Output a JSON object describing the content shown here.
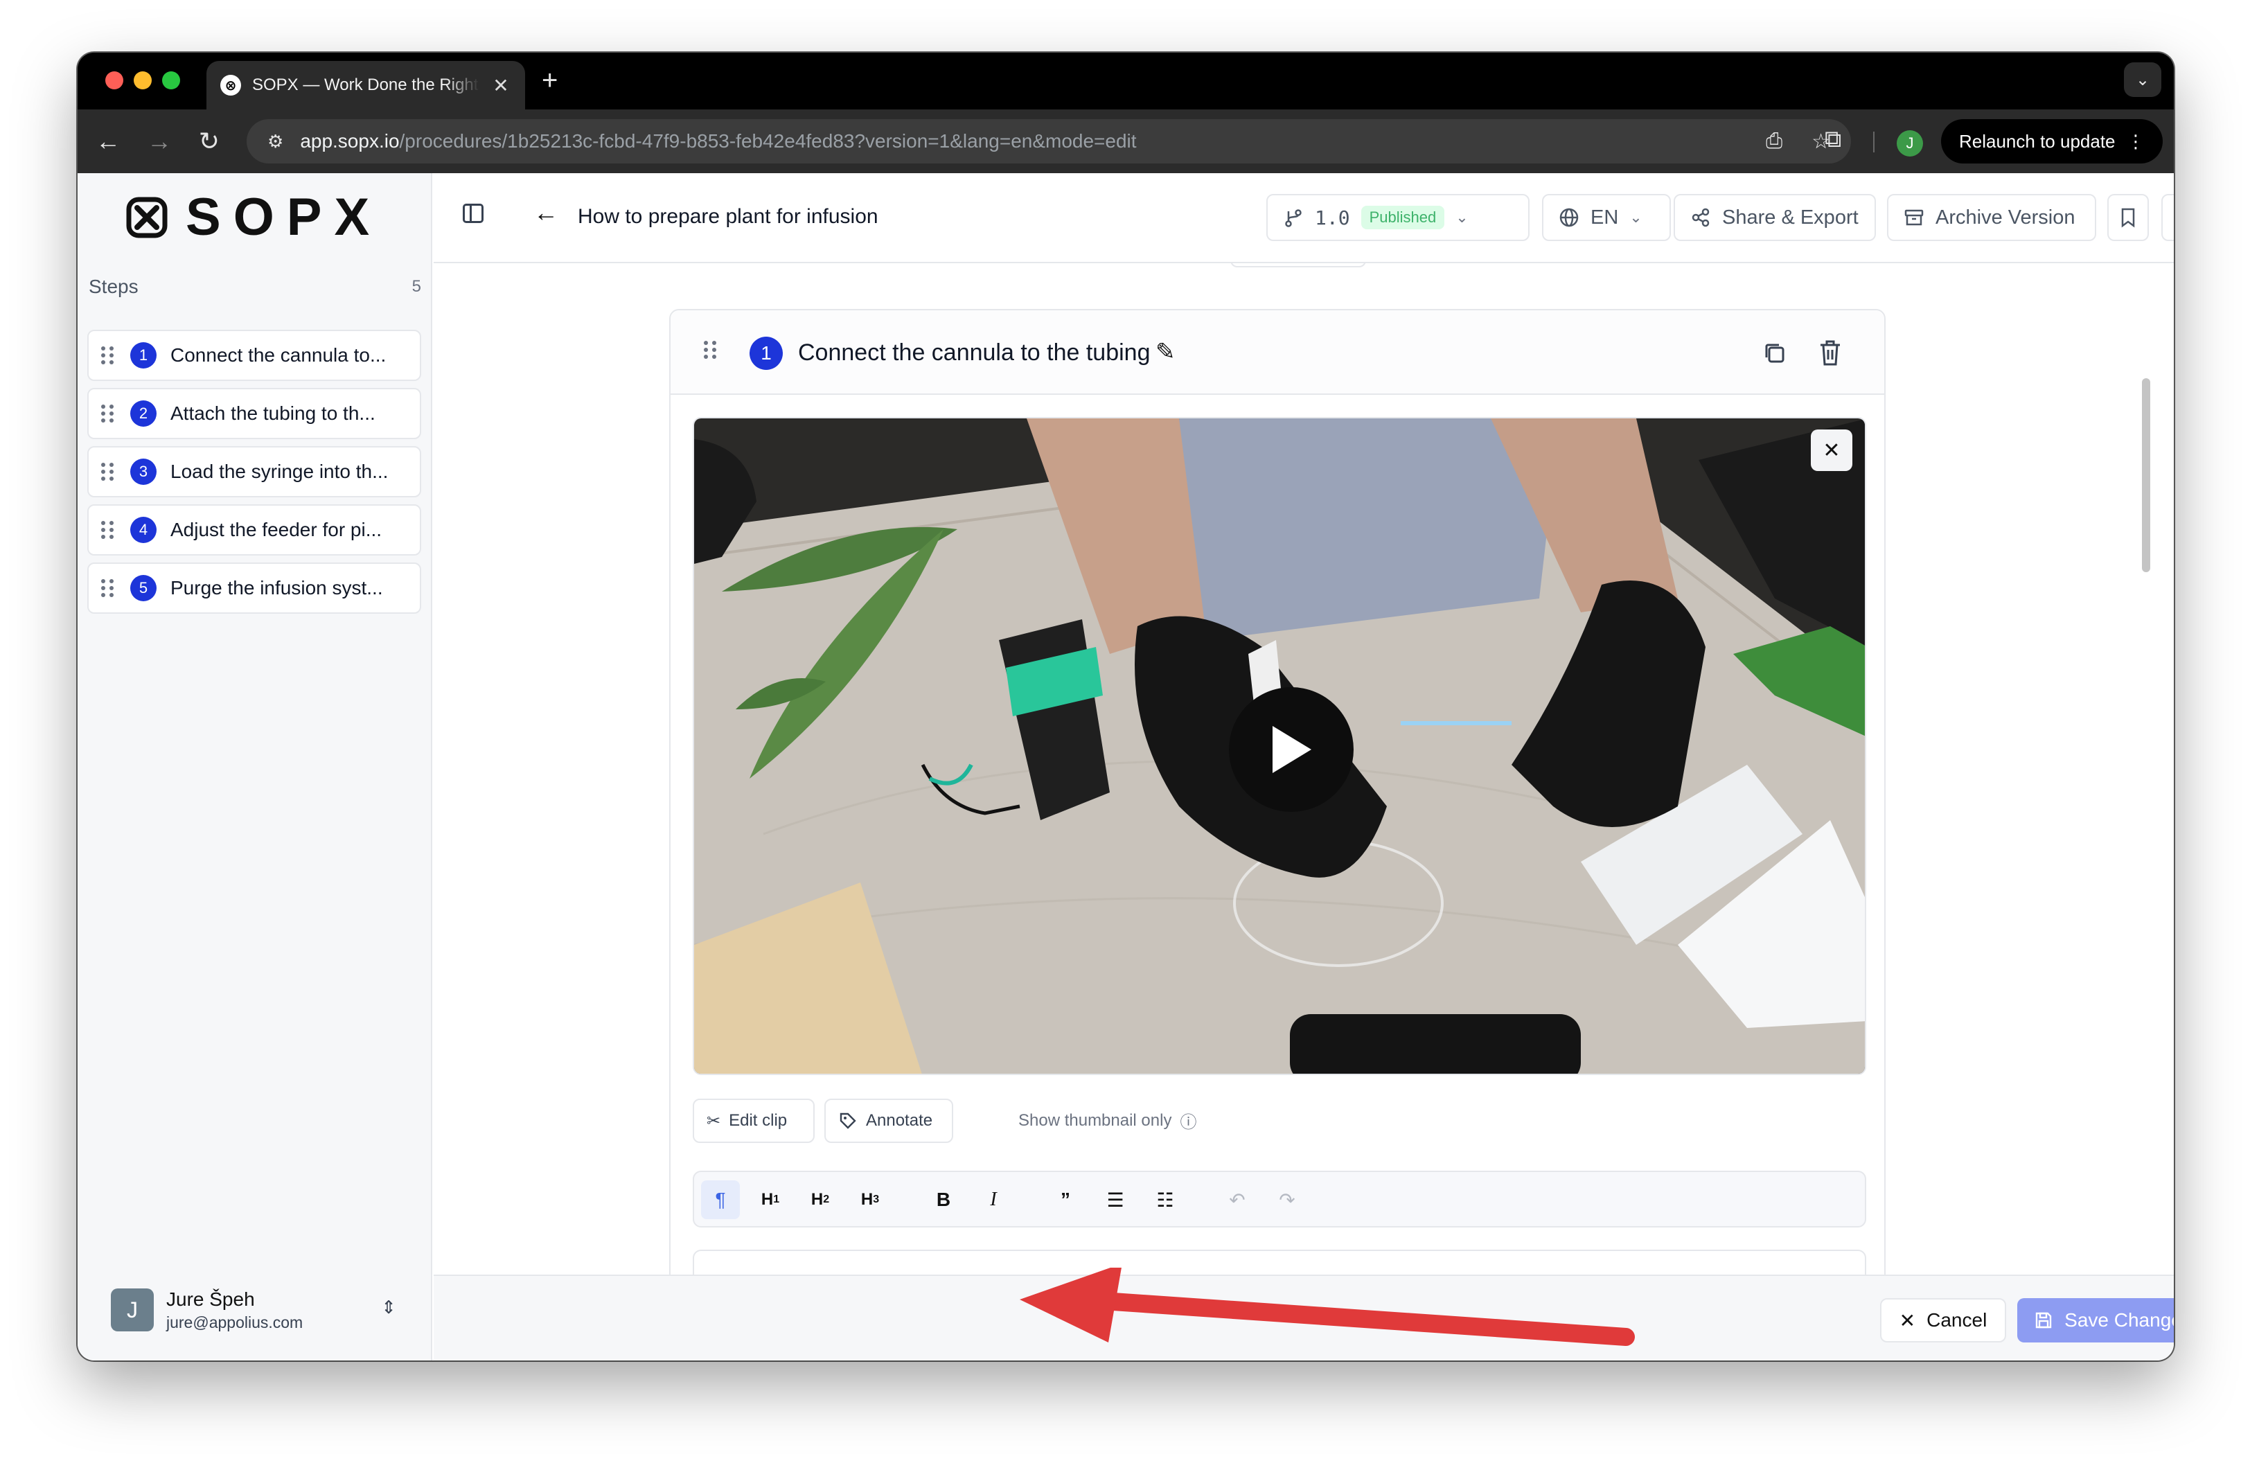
{
  "browser": {
    "tab_title": "SOPX — Work Done the Right Way",
    "url_host": "app.sopx.io",
    "url_path": "/procedures/1b25213c-fcbd-47f9-b853-feb42e4fed83?version=1&lang=en&mode=edit",
    "profile_initial": "J",
    "relaunch_label": "Relaunch to update"
  },
  "sidebar": {
    "logo_text": "SOPX",
    "steps_label": "Steps",
    "steps_count": "5",
    "steps": [
      {
        "num": "1",
        "label": "Connect the cannula to..."
      },
      {
        "num": "2",
        "label": "Attach the tubing to th..."
      },
      {
        "num": "3",
        "label": "Load the syringe into th..."
      },
      {
        "num": "4",
        "label": "Adjust the feeder for pi..."
      },
      {
        "num": "5",
        "label": "Purge the infusion syst..."
      }
    ],
    "user": {
      "initial": "J",
      "name": "Jure Špeh",
      "email": "jure@appolius.com"
    }
  },
  "header": {
    "title": "How to prepare plant for infusion",
    "version": "1.0",
    "status": "Published",
    "language": "EN",
    "share_label": "Share & Export",
    "archive_label": "Archive Version"
  },
  "step_card": {
    "number": "1",
    "title": "Connect the cannula to the tubing",
    "edit_clip_label": "Edit clip",
    "annotate_label": "Annotate",
    "thumbnail_only_label": "Show thumbnail only"
  },
  "editor": {
    "paragraph_label": "¶",
    "h1": "H",
    "h2": "H",
    "h3": "H"
  },
  "footer": {
    "cancel_label": "Cancel",
    "save_label": "Save Changes"
  },
  "colors": {
    "accent": "#1d35d9",
    "save_button": "#8d9cf2",
    "published_badge": "#dcfce7",
    "annotation_arrow": "#e03a3a"
  }
}
